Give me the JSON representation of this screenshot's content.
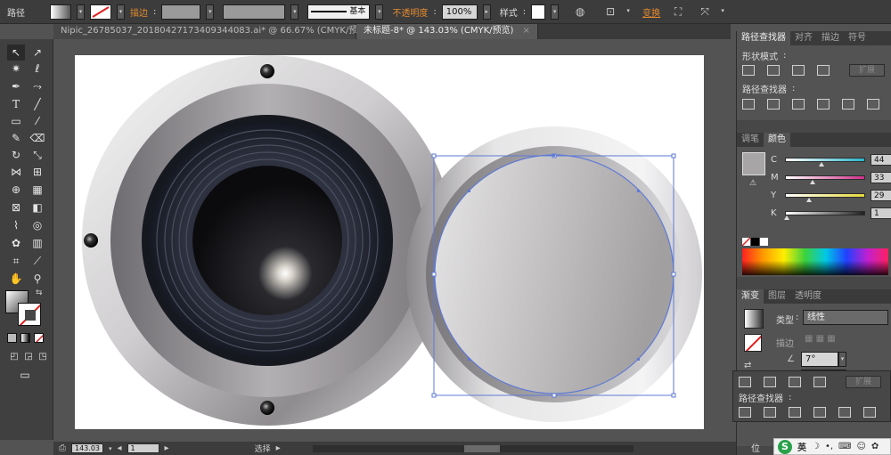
{
  "control_bar": {
    "selection_type": "路径",
    "stroke_label": "描边",
    "stroke_weight_label": "基本",
    "opacity_label": "不透明度",
    "opacity_value": "100%",
    "style_label": "样式",
    "transform_label": "变换"
  },
  "tabs": [
    {
      "label": "Nipic_26785037_20180427173409344083.ai* @ 66.67% (CMYK/预览)",
      "close": "×"
    },
    {
      "label": "未标题-8* @ 143.03% (CMYK/预览)",
      "close": "×"
    }
  ],
  "pathfinder_panel": {
    "tabs": [
      "路径查找器",
      "对齐",
      "描边",
      "符号"
    ],
    "shape_modes_label": "形状模式",
    "expand_label": "扩展",
    "pathfinders_label": "路径查找器"
  },
  "color_panel": {
    "tabs": [
      "调笔",
      "颜色"
    ],
    "channels": [
      {
        "name": "C",
        "value": "44",
        "fraction": 0.44,
        "color": "#2bb3c8"
      },
      {
        "name": "M",
        "value": "33",
        "fraction": 0.33,
        "color": "#d0308a"
      },
      {
        "name": "Y",
        "value": "29",
        "fraction": 0.29,
        "color": "#e5d93a"
      },
      {
        "name": "K",
        "value": "1",
        "fraction": 0.01,
        "color": "#202020"
      }
    ],
    "fill_color": "#a7a5a6"
  },
  "gradient_panel": {
    "tabs": [
      "渐变",
      "图层",
      "透明度"
    ],
    "type_label": "类型",
    "type_value": "线性",
    "stroke_label": "描边",
    "angle_value": "7°"
  },
  "float_palette": {
    "expand_label": "扩展",
    "pathfinders_label": "路径查找器"
  },
  "status_bar": {
    "zoom": "143.03",
    "artboard_number": "1",
    "tool_label": "选择"
  },
  "ime": {
    "logo": "S",
    "lang": "英",
    "position_label": "位"
  }
}
